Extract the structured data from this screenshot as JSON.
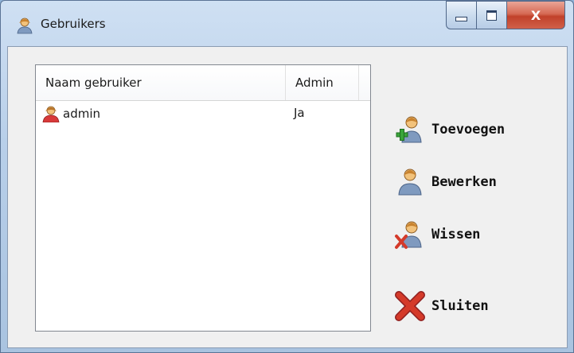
{
  "window": {
    "title": "Gebruikers",
    "close_glyph": "X"
  },
  "list": {
    "columns": [
      "Naam gebruiker",
      "Admin"
    ],
    "rows": [
      {
        "name": "admin",
        "admin": "Ja",
        "icon": "user-icon-red"
      }
    ]
  },
  "actions": {
    "add": {
      "label": "Toevoegen",
      "icon": "user-add-icon"
    },
    "edit": {
      "label": "Bewerken",
      "icon": "user-edit-icon"
    },
    "delete": {
      "label": "Wissen",
      "icon": "user-delete-icon"
    },
    "close": {
      "label": "Sluiten",
      "icon": "red-x-icon"
    }
  },
  "colors": {
    "user_body": "#6f8bb3",
    "user_face": "#f2c27b",
    "admin_body": "#d83a3a",
    "add_green": "#3aa53a",
    "delete_red": "#d43a2a"
  }
}
